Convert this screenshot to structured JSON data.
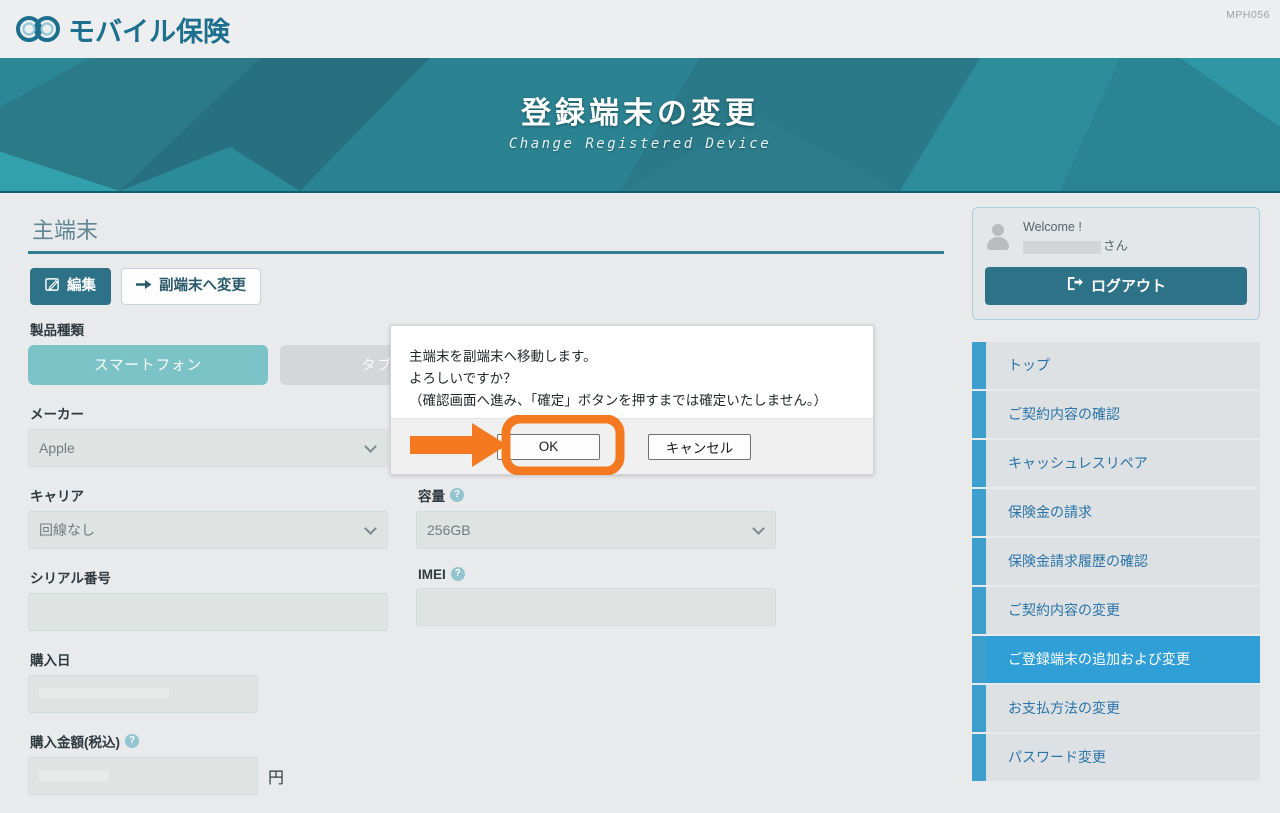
{
  "header": {
    "logo_text": "モバイル保険",
    "logo_icon": "double-ring-icon",
    "page_code": "MPH056"
  },
  "hero": {
    "title": "登録端末の変更",
    "subtitle": "Change Registered Device"
  },
  "main": {
    "section_title": "主端末",
    "actions": [
      {
        "label": "編集",
        "icon": "pencil-square-icon",
        "style": "primary"
      },
      {
        "label": "副端末へ変更",
        "icon": "arrow-right-icon",
        "style": "outline"
      }
    ],
    "fields": {
      "product_type": {
        "label": "製品種類",
        "options": [
          "スマートフォン",
          "タブレット"
        ],
        "selected": "スマートフォン"
      },
      "maker": {
        "label": "メーカー",
        "value": "Apple"
      },
      "carrier": {
        "label": "キャリア",
        "value": "回線なし"
      },
      "capacity": {
        "label": "容量",
        "value": "256GB",
        "has_help": true
      },
      "serial": {
        "label": "シリアル番号",
        "value": ""
      },
      "imei": {
        "label": "IMEI",
        "value": "",
        "has_help": true
      },
      "purchase_date": {
        "label": "購入日",
        "value": ""
      },
      "purchase_amount": {
        "label": "購入金額(税込)",
        "value": "",
        "has_help": true,
        "suffix": "円"
      }
    }
  },
  "dialog": {
    "lines": [
      "主端末を副端末へ移動します。",
      "よろしいですか？",
      "（確認画面へ進み、「確定」ボタンを押すまでは確定いたしません。）"
    ],
    "ok_label": "OK",
    "cancel_label": "キャンセル",
    "highlight_color": "#f47920",
    "highlighted_button": "OK"
  },
  "aside": {
    "welcome": {
      "greeting": "Welcome !",
      "name_suffix": "さん",
      "logout_label": "ログアウト",
      "logout_icon": "logout-icon",
      "avatar_icon": "user-avatar-icon"
    },
    "nav": [
      {
        "label": "トップ",
        "active": false
      },
      {
        "label": "ご契約内容の確認",
        "active": false
      },
      {
        "label": "キャッシュレスリペア",
        "active": false
      },
      {
        "label": "保険金の請求",
        "active": false
      },
      {
        "label": "保険金請求履歴の確認",
        "active": false
      },
      {
        "label": "ご契約内容の変更",
        "active": false
      },
      {
        "label": "ご登録端末の追加および変更",
        "active": true
      },
      {
        "label": "お支払方法の変更",
        "active": false
      },
      {
        "label": "パスワード変更",
        "active": false
      }
    ]
  },
  "colors": {
    "brand_teal": "#2e7288",
    "hero_teal": "#2a7e8c",
    "accent_orange": "#f47920",
    "nav_blue": "#2f9fd6",
    "segment_on": "#7cc3c8"
  }
}
